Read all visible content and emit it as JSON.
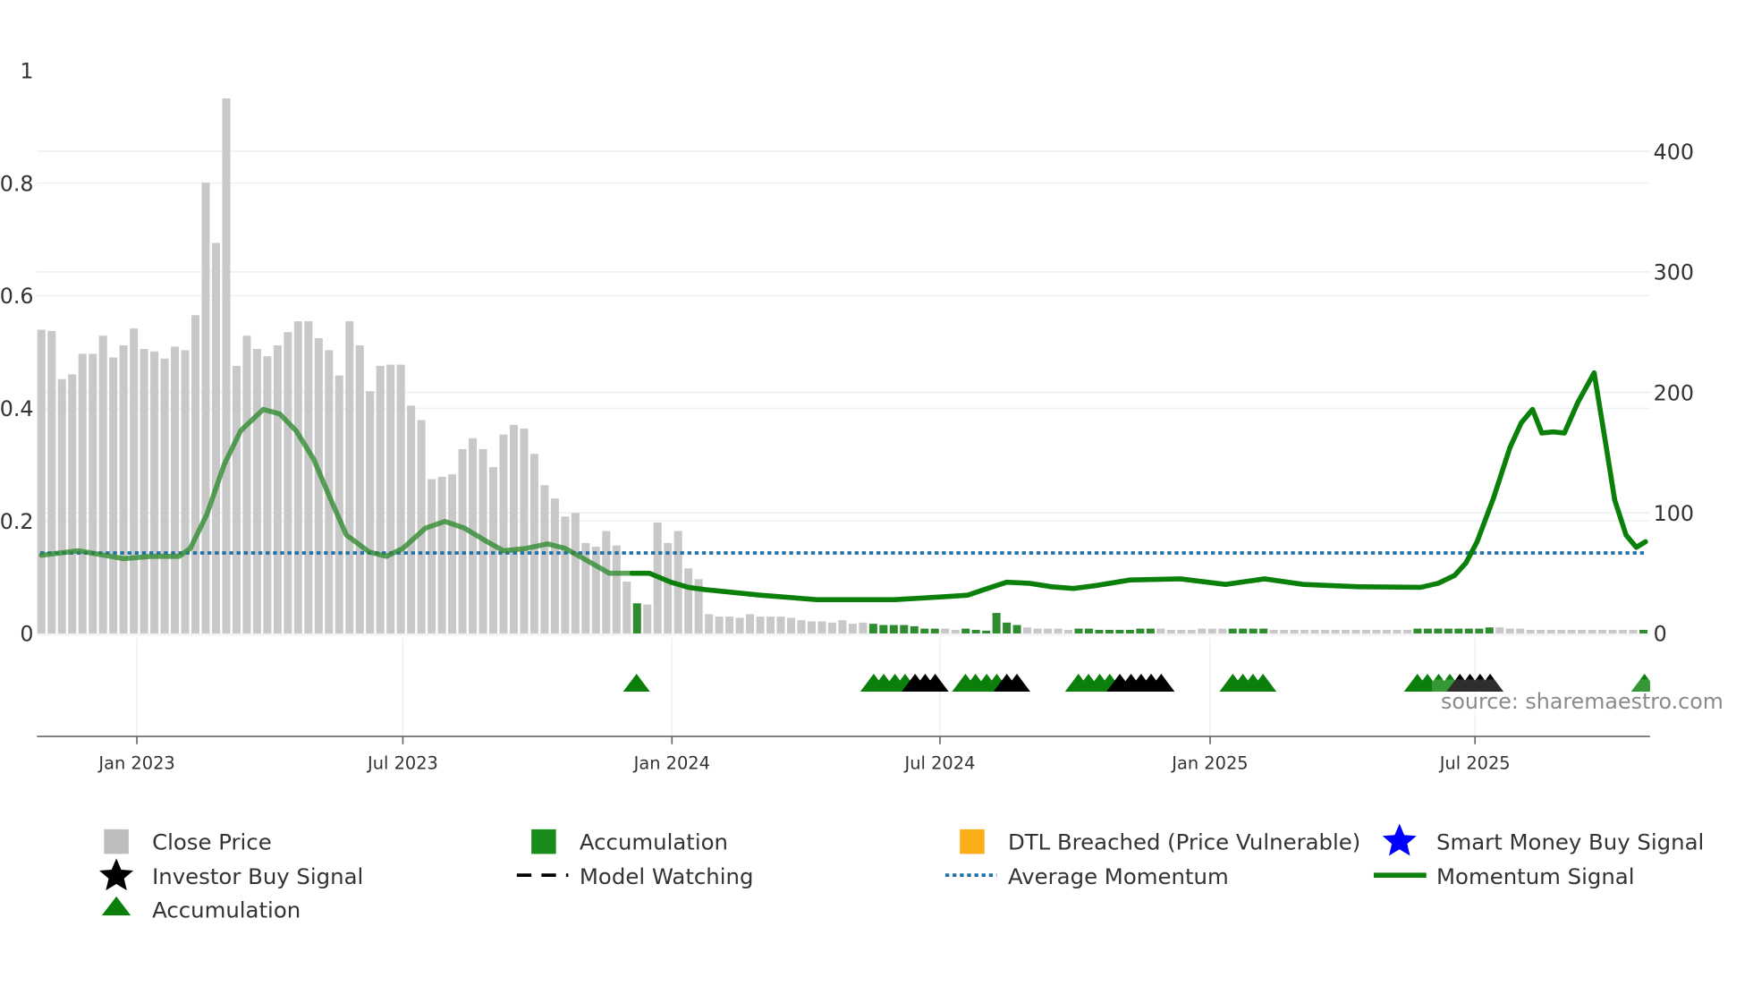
{
  "chart_data": {
    "type": "bar+line",
    "title": "",
    "source_label": "source: sharemaestro.com",
    "left_axis": {
      "ticks": [
        "0",
        "0.2",
        "0.4",
        "0.6",
        "0.8",
        "1"
      ],
      "tick_values": [
        0,
        0.2,
        0.4,
        0.6,
        0.8,
        1
      ],
      "range": [
        0,
        1
      ]
    },
    "right_axis": {
      "ticks": [
        "0",
        "100",
        "200",
        "300",
        "400"
      ],
      "tick_values": [
        0,
        100,
        200,
        300,
        400
      ]
    },
    "x_axis": {
      "ticks": [
        "Jan 2023",
        "Jul 2023",
        "Jan 2024",
        "Jul 2024",
        "Jan 2025",
        "Jul 2025"
      ],
      "tick_weeks": [
        9.3,
        35.2,
        61.4,
        87.5,
        113.8,
        139.6
      ]
    },
    "close_price": {
      "axis": "right",
      "interval": "weekly",
      "values": [
        252,
        251,
        211,
        215,
        232,
        232,
        247,
        229,
        239,
        253,
        236,
        234,
        228,
        238,
        235,
        264,
        374,
        324,
        444,
        222,
        247,
        236,
        230,
        239,
        250,
        259,
        259,
        245,
        235,
        214,
        259,
        239,
        201,
        222,
        223,
        223,
        189,
        177,
        128,
        130,
        132,
        153,
        162,
        153,
        138,
        165,
        173,
        170,
        149,
        123,
        112,
        97,
        100,
        75,
        72,
        85,
        73,
        43,
        25,
        24,
        92,
        75,
        85,
        54,
        45,
        16,
        14,
        14,
        13,
        16,
        14,
        14,
        14,
        13,
        11,
        10,
        10,
        9,
        11,
        8,
        9,
        8,
        7,
        7,
        7,
        6,
        4,
        4,
        4,
        3,
        4,
        3,
        2,
        17,
        9,
        7,
        5,
        4,
        4,
        4,
        3,
        4,
        4,
        3,
        3,
        3,
        3,
        4,
        4,
        4,
        3,
        3,
        3,
        4,
        4,
        4,
        4,
        4,
        4,
        4,
        3,
        3,
        3,
        3,
        3,
        3,
        3,
        3,
        3,
        3,
        3,
        3,
        3,
        3,
        4,
        4,
        4,
        4,
        4,
        4,
        4,
        5,
        5,
        4,
        4,
        3,
        3,
        3,
        3,
        3,
        3,
        3,
        3,
        3,
        3,
        3,
        3
      ],
      "accumulation_weeks": [
        58,
        81,
        82,
        83,
        84,
        85,
        86,
        87,
        90,
        91,
        92,
        93,
        94,
        95,
        101,
        102,
        103,
        104,
        105,
        106,
        107,
        108,
        116,
        117,
        118,
        119,
        134,
        135,
        136,
        137,
        138,
        139,
        140,
        141,
        156
      ]
    },
    "momentum_signal": {
      "axis": "left",
      "points": [
        [
          0,
          0.139
        ],
        [
          3.6,
          0.147
        ],
        [
          8,
          0.133
        ],
        [
          10.7,
          0.137
        ],
        [
          13.4,
          0.137
        ],
        [
          14.5,
          0.151
        ],
        [
          16.1,
          0.211
        ],
        [
          17.8,
          0.3
        ],
        [
          19.4,
          0.36
        ],
        [
          21.6,
          0.398
        ],
        [
          23.2,
          0.39
        ],
        [
          24.8,
          0.36
        ],
        [
          26.5,
          0.31
        ],
        [
          28.1,
          0.241
        ],
        [
          29.7,
          0.175
        ],
        [
          31.9,
          0.145
        ],
        [
          33.6,
          0.137
        ],
        [
          35.2,
          0.151
        ],
        [
          37.4,
          0.187
        ],
        [
          39.3,
          0.199
        ],
        [
          41.2,
          0.187
        ],
        [
          43.4,
          0.163
        ],
        [
          45,
          0.147
        ],
        [
          47.2,
          0.151
        ],
        [
          49.3,
          0.159
        ],
        [
          51,
          0.151
        ],
        [
          52.6,
          0.135
        ],
        [
          55.3,
          0.107
        ],
        [
          57.5,
          0.107
        ],
        [
          59.2,
          0.107
        ],
        [
          61.3,
          0.091
        ],
        [
          63,
          0.082
        ],
        [
          64.6,
          0.078
        ],
        [
          70,
          0.068
        ],
        [
          75.5,
          0.06
        ],
        [
          83.1,
          0.06
        ],
        [
          88.6,
          0.066
        ],
        [
          90.2,
          0.068
        ],
        [
          91.8,
          0.078
        ],
        [
          94,
          0.091
        ],
        [
          96.2,
          0.089
        ],
        [
          98.4,
          0.083
        ],
        [
          100.5,
          0.08
        ],
        [
          102.7,
          0.085
        ],
        [
          106,
          0.095
        ],
        [
          110.9,
          0.097
        ],
        [
          115.3,
          0.087
        ],
        [
          119.1,
          0.097
        ],
        [
          122.9,
          0.087
        ],
        [
          128.3,
          0.083
        ],
        [
          134.3,
          0.082
        ],
        [
          136,
          0.089
        ],
        [
          137.6,
          0.103
        ],
        [
          138.7,
          0.125
        ],
        [
          139.8,
          0.163
        ],
        [
          141.4,
          0.241
        ],
        [
          143,
          0.33
        ],
        [
          144.1,
          0.374
        ],
        [
          145.2,
          0.398
        ],
        [
          146.1,
          0.356
        ],
        [
          147.2,
          0.358
        ],
        [
          148.3,
          0.356
        ],
        [
          149.6,
          0.41
        ],
        [
          151.2,
          0.463
        ],
        [
          152.3,
          0.34
        ],
        [
          153.2,
          0.237
        ],
        [
          154.3,
          0.175
        ],
        [
          155.3,
          0.153
        ],
        [
          156.2,
          0.163
        ]
      ],
      "faded_until_week": 57.5
    },
    "average_momentum": 0.143,
    "signals": {
      "accumulation_triangles": [
        569,
        781,
        790,
        800,
        809,
        863,
        872,
        882,
        891,
        964,
        973,
        983,
        992,
        1102,
        1111,
        1120,
        1129,
        1267,
        1276,
        1286,
        1296,
        1470
      ],
      "investor_buy_triangles": [
        818,
        827,
        836,
        900,
        909,
        1001,
        1011,
        1020,
        1029,
        1038,
        1305,
        1314,
        1323,
        1332
      ]
    },
    "colors": {
      "bar": "#c8c8c8",
      "accumulation": "#2e8b2e",
      "momentum": "#0a800a",
      "average": "#1f6fa8",
      "orange": "#fbae17",
      "blue": "#0000ff"
    },
    "legend": [
      {
        "label": "Close Price",
        "icon": "grey-square"
      },
      {
        "label": "Accumulation",
        "icon": "green-square"
      },
      {
        "label": "DTL Breached (Price Vulnerable)",
        "icon": "orange-square"
      },
      {
        "label": "Smart Money Buy Signal",
        "icon": "blue-star"
      },
      {
        "label": "Investor Buy Signal",
        "icon": "black-star"
      },
      {
        "label": "Model Watching",
        "icon": "black-dashed-line"
      },
      {
        "label": "Average Momentum",
        "icon": "blue-dotted-line"
      },
      {
        "label": "Momentum Signal",
        "icon": "green-line"
      },
      {
        "label": "Accumulation",
        "icon": "green-triangle"
      }
    ]
  }
}
